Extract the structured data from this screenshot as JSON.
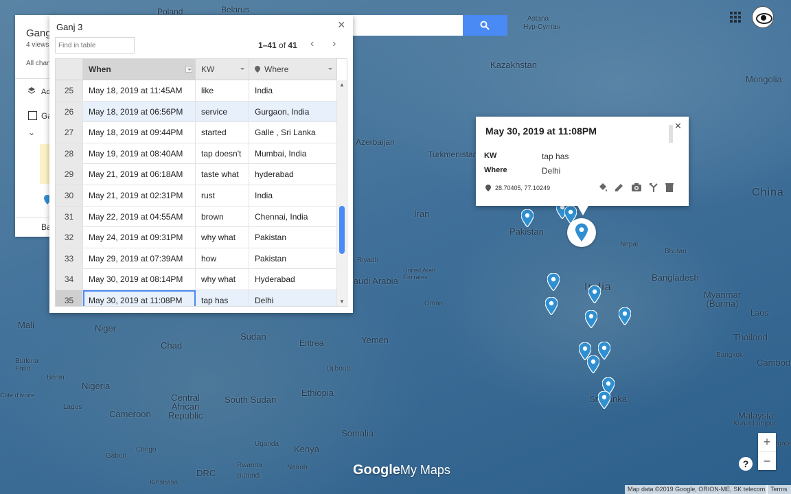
{
  "map": {
    "labels": [
      {
        "text": "Poland",
        "cls": "land-label"
      },
      {
        "text": "Belarus",
        "cls": "land-label"
      },
      {
        "text": "Astana",
        "cls": "land-label"
      },
      {
        "text": "Нур-Султан",
        "cls": "land-label"
      },
      {
        "text": "Kazakhstan",
        "cls": "land-label lg"
      },
      {
        "text": "Mongolia",
        "cls": "land-label lg"
      },
      {
        "text": "Azerbaijan",
        "cls": "land-label"
      },
      {
        "text": "Turkmenistan",
        "cls": "land-label"
      },
      {
        "text": "Iran",
        "cls": "land-label lg"
      },
      {
        "text": "Pakistan",
        "cls": "land-label lg"
      },
      {
        "text": "Nepal",
        "cls": "land-label"
      },
      {
        "text": "Bhutan",
        "cls": "land-label"
      },
      {
        "text": "China",
        "cls": "land-label xl"
      },
      {
        "text": "Riyadh",
        "cls": "land-label"
      },
      {
        "text": "Saudi Arabia",
        "cls": "land-label lg"
      },
      {
        "text": "United Arab Emirates",
        "cls": "land-label"
      },
      {
        "text": "Oman",
        "cls": "land-label"
      },
      {
        "text": "India",
        "cls": "land-label xl"
      },
      {
        "text": "Bangladesh",
        "cls": "land-label lg"
      },
      {
        "text": "Myanmar (Burma)",
        "cls": "land-label lg"
      },
      {
        "text": "Laos",
        "cls": "land-label"
      },
      {
        "text": "Thailand",
        "cls": "land-label lg"
      },
      {
        "text": "Cambodia",
        "cls": "land-label lg"
      },
      {
        "text": "Mali",
        "cls": "land-label lg"
      },
      {
        "text": "Niger",
        "cls": "land-label lg"
      },
      {
        "text": "Chad",
        "cls": "land-label lg"
      },
      {
        "text": "Sudan",
        "cls": "land-label lg"
      },
      {
        "text": "Eritrea",
        "cls": "land-label"
      },
      {
        "text": "Yemen",
        "cls": "land-label lg"
      },
      {
        "text": "Djibouti",
        "cls": "land-label"
      },
      {
        "text": "Burkina Faso",
        "cls": "land-label"
      },
      {
        "text": "Benin",
        "cls": "land-label"
      },
      {
        "text": "Nigeria",
        "cls": "land-label lg"
      },
      {
        "text": "Central African Republic",
        "cls": "land-label lg"
      },
      {
        "text": "South Sudan",
        "cls": "land-label lg"
      },
      {
        "text": "Ethiopia",
        "cls": "land-label lg"
      },
      {
        "text": "Cameroon",
        "cls": "land-label lg"
      },
      {
        "text": "Somalia",
        "cls": "land-label lg"
      },
      {
        "text": "Lagos",
        "cls": "land-label"
      },
      {
        "text": "Côte d'Ivoire",
        "cls": "land-label"
      },
      {
        "text": "Gabon",
        "cls": "land-label"
      },
      {
        "text": "Congo",
        "cls": "land-label"
      },
      {
        "text": "Uganda",
        "cls": "land-label"
      },
      {
        "text": "Kenya",
        "cls": "land-label lg"
      },
      {
        "text": "Nairobi",
        "cls": "land-label"
      },
      {
        "text": "Rwanda",
        "cls": "land-label"
      },
      {
        "text": "Burundi",
        "cls": "land-label"
      },
      {
        "text": "DRC",
        "cls": "land-label lg"
      },
      {
        "text": "Kinshasa",
        "cls": "land-label"
      },
      {
        "text": "Sri Lanka",
        "cls": "land-label lg"
      },
      {
        "text": "Bangkok",
        "cls": "land-label"
      },
      {
        "text": "Malaysia",
        "cls": "land-label lg"
      },
      {
        "text": "Kuala Lumpur",
        "cls": "land-label"
      },
      {
        "text": "Singapore",
        "cls": "land-label"
      }
    ]
  },
  "header": {
    "apps_icon": "apps-grid-icon",
    "avatar_icon": "eye-avatar-icon",
    "search_icon": "search-icon",
    "search_button_color": "#4a8af4"
  },
  "layer_panel": {
    "title": "Gang",
    "views": "4 views",
    "all_changes": "All chan",
    "add_layer": "Ad",
    "layer_name": "Ga",
    "base_layer": "Ba",
    "note_text": "T\nF\nt"
  },
  "table": {
    "title": "Ganj 3",
    "find_placeholder": "Find in table",
    "count_range": "1–41",
    "count_of": "of",
    "count_total": "41",
    "columns": {
      "when": "When",
      "kw": "KW",
      "where": "Where"
    },
    "rows": [
      {
        "idx": "25",
        "when": "May 18, 2019 at 11:45AM",
        "kw": "like",
        "where": "India"
      },
      {
        "idx": "26",
        "when": "May 18, 2019 at 06:56PM",
        "kw": "service",
        "where": "Gurgaon, India"
      },
      {
        "idx": "27",
        "when": "May 18, 2019 at 09:44PM",
        "kw": "started",
        "where": "Galle , Sri Lanka"
      },
      {
        "idx": "28",
        "when": "May 19, 2019 at 08:40AM",
        "kw": "tap doesn't",
        "where": "Mumbai, India"
      },
      {
        "idx": "29",
        "when": "May 21, 2019 at 06:18AM",
        "kw": "taste what",
        "where": "hyderabad"
      },
      {
        "idx": "30",
        "when": "May 21, 2019 at 02:31PM",
        "kw": "rust",
        "where": "India"
      },
      {
        "idx": "31",
        "when": "May 22, 2019 at 04:55AM",
        "kw": "brown",
        "where": "Chennai, India"
      },
      {
        "idx": "32",
        "when": "May 24, 2019 at 09:31PM",
        "kw": "why what",
        "where": "Pakistan"
      },
      {
        "idx": "33",
        "when": "May 29, 2019 at 07:39AM",
        "kw": "how",
        "where": "Pakistan"
      },
      {
        "idx": "34",
        "when": "May 30, 2019 at 08:14PM",
        "kw": "why what",
        "where": "Hyderabad"
      },
      {
        "idx": "35",
        "when": "May 30, 2019 at 11:08PM",
        "kw": "tap has",
        "where": "Delhi"
      }
    ]
  },
  "info_card": {
    "title": "May 30, 2019 at 11:08PM",
    "kw_label": "KW",
    "kw_value": "tap has",
    "where_label": "Where",
    "where_value": "Delhi",
    "coords": "28.70405, 77.10249",
    "tools": [
      "paint-bucket-icon",
      "pencil-icon",
      "camera-icon",
      "directions-icon",
      "trash-icon"
    ]
  },
  "markers": {
    "color": "#2f8fd1",
    "count": 14
  },
  "controls": {
    "zoom_in": "+",
    "zoom_out": "−",
    "help": "?"
  },
  "footer": {
    "brand_google": "Google",
    "brand_mymaps": "My Maps",
    "attribution": "Map data ©2019 Google, ORION-ME, SK telecom",
    "terms": "Terms"
  }
}
